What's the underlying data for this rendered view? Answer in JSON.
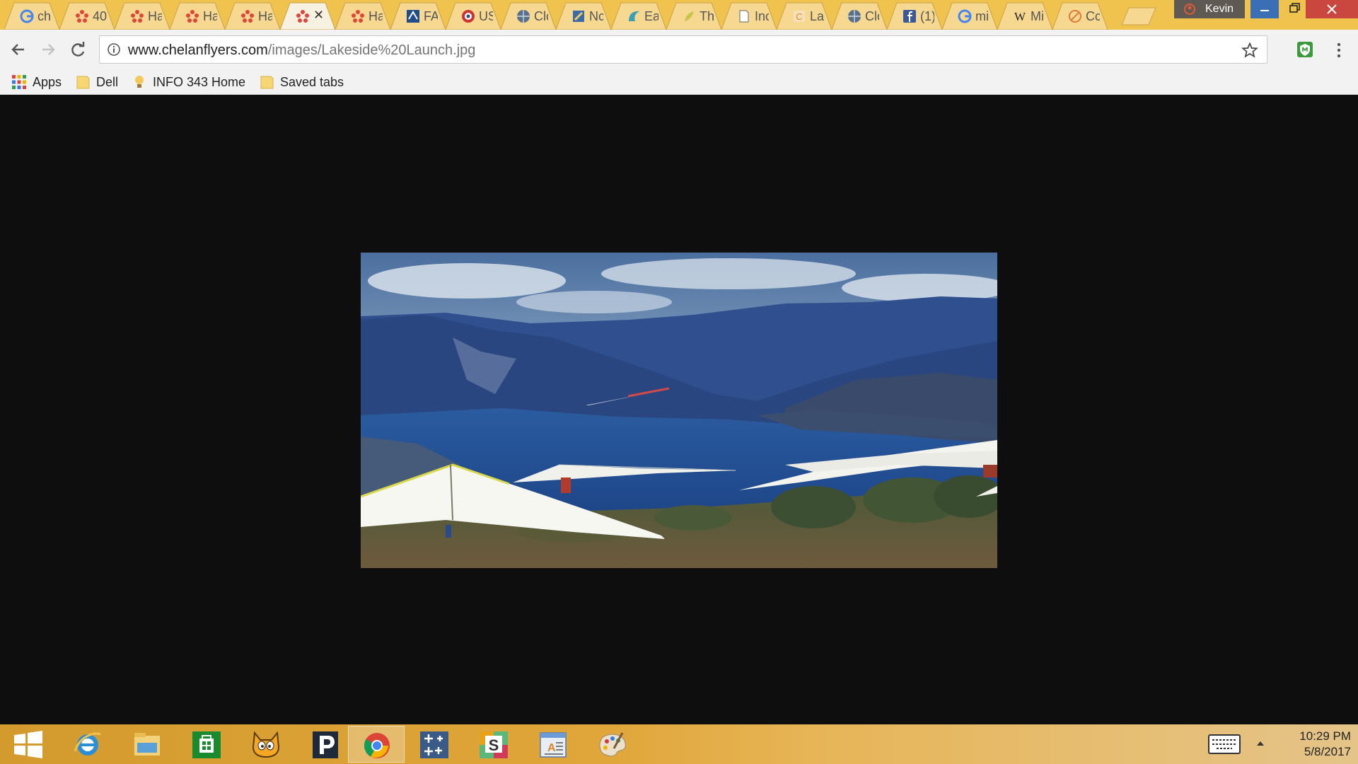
{
  "tabs": [
    {
      "icon": "google-g-icon",
      "label": "ch"
    },
    {
      "icon": "red-dots-icon",
      "label": "40"
    },
    {
      "icon": "red-dots-icon",
      "label": "Ha"
    },
    {
      "icon": "red-dots-icon",
      "label": "Ha"
    },
    {
      "icon": "red-dots-icon",
      "label": "Ha"
    },
    {
      "icon": "red-dots-icon",
      "label": "",
      "active": true
    },
    {
      "icon": "red-dots-icon",
      "label": "Ha"
    },
    {
      "icon": "fa-icon",
      "label": "FA"
    },
    {
      "icon": "usa-icon",
      "label": "US"
    },
    {
      "icon": "globe-icon",
      "label": "Clc"
    },
    {
      "icon": "note-icon",
      "label": "Nc"
    },
    {
      "icon": "wave-icon",
      "label": "Ea"
    },
    {
      "icon": "leaf-icon",
      "label": "Th"
    },
    {
      "icon": "page-icon",
      "label": "Inc"
    },
    {
      "icon": "c-icon",
      "label": "La"
    },
    {
      "icon": "globe-icon",
      "label": "Clc"
    },
    {
      "icon": "facebook-icon",
      "label": "(1)"
    },
    {
      "icon": "google-g-icon",
      "label": "mi"
    },
    {
      "icon": "wikipedia-icon",
      "label": "Mi"
    },
    {
      "icon": "no-entry-icon",
      "label": "Cc"
    }
  ],
  "profile": {
    "name": "Kevin"
  },
  "address_bar": {
    "host": "www.chelanflyers.com",
    "path": "/images/Lakeside%20Launch.jpg"
  },
  "bookmarks": [
    {
      "icon": "apps-grid-icon",
      "label": "Apps"
    },
    {
      "icon": "folder-icon",
      "label": "Dell"
    },
    {
      "icon": "lightbulb-icon",
      "label": "INFO 343 Home"
    },
    {
      "icon": "folder-icon",
      "label": "Saved tabs"
    }
  ],
  "photo": {
    "subject": "hang-gliders-lake-photo"
  },
  "taskbar": {
    "apps": [
      "start-icon",
      "internet-explorer-icon",
      "file-explorer-icon",
      "store-icon",
      "scratch-icon",
      "pandora-icon",
      "chrome-icon",
      "snipping-icon",
      "slack-icon",
      "wordpad-icon",
      "paint-icon"
    ],
    "active_app": "chrome-icon"
  },
  "clock": {
    "time": "10:29 PM",
    "date": "5/8/2017"
  },
  "colors": {
    "titlebar": "#f0c34e",
    "viewer_bg": "#0e0e0e",
    "taskbar": "#d39a2e"
  }
}
